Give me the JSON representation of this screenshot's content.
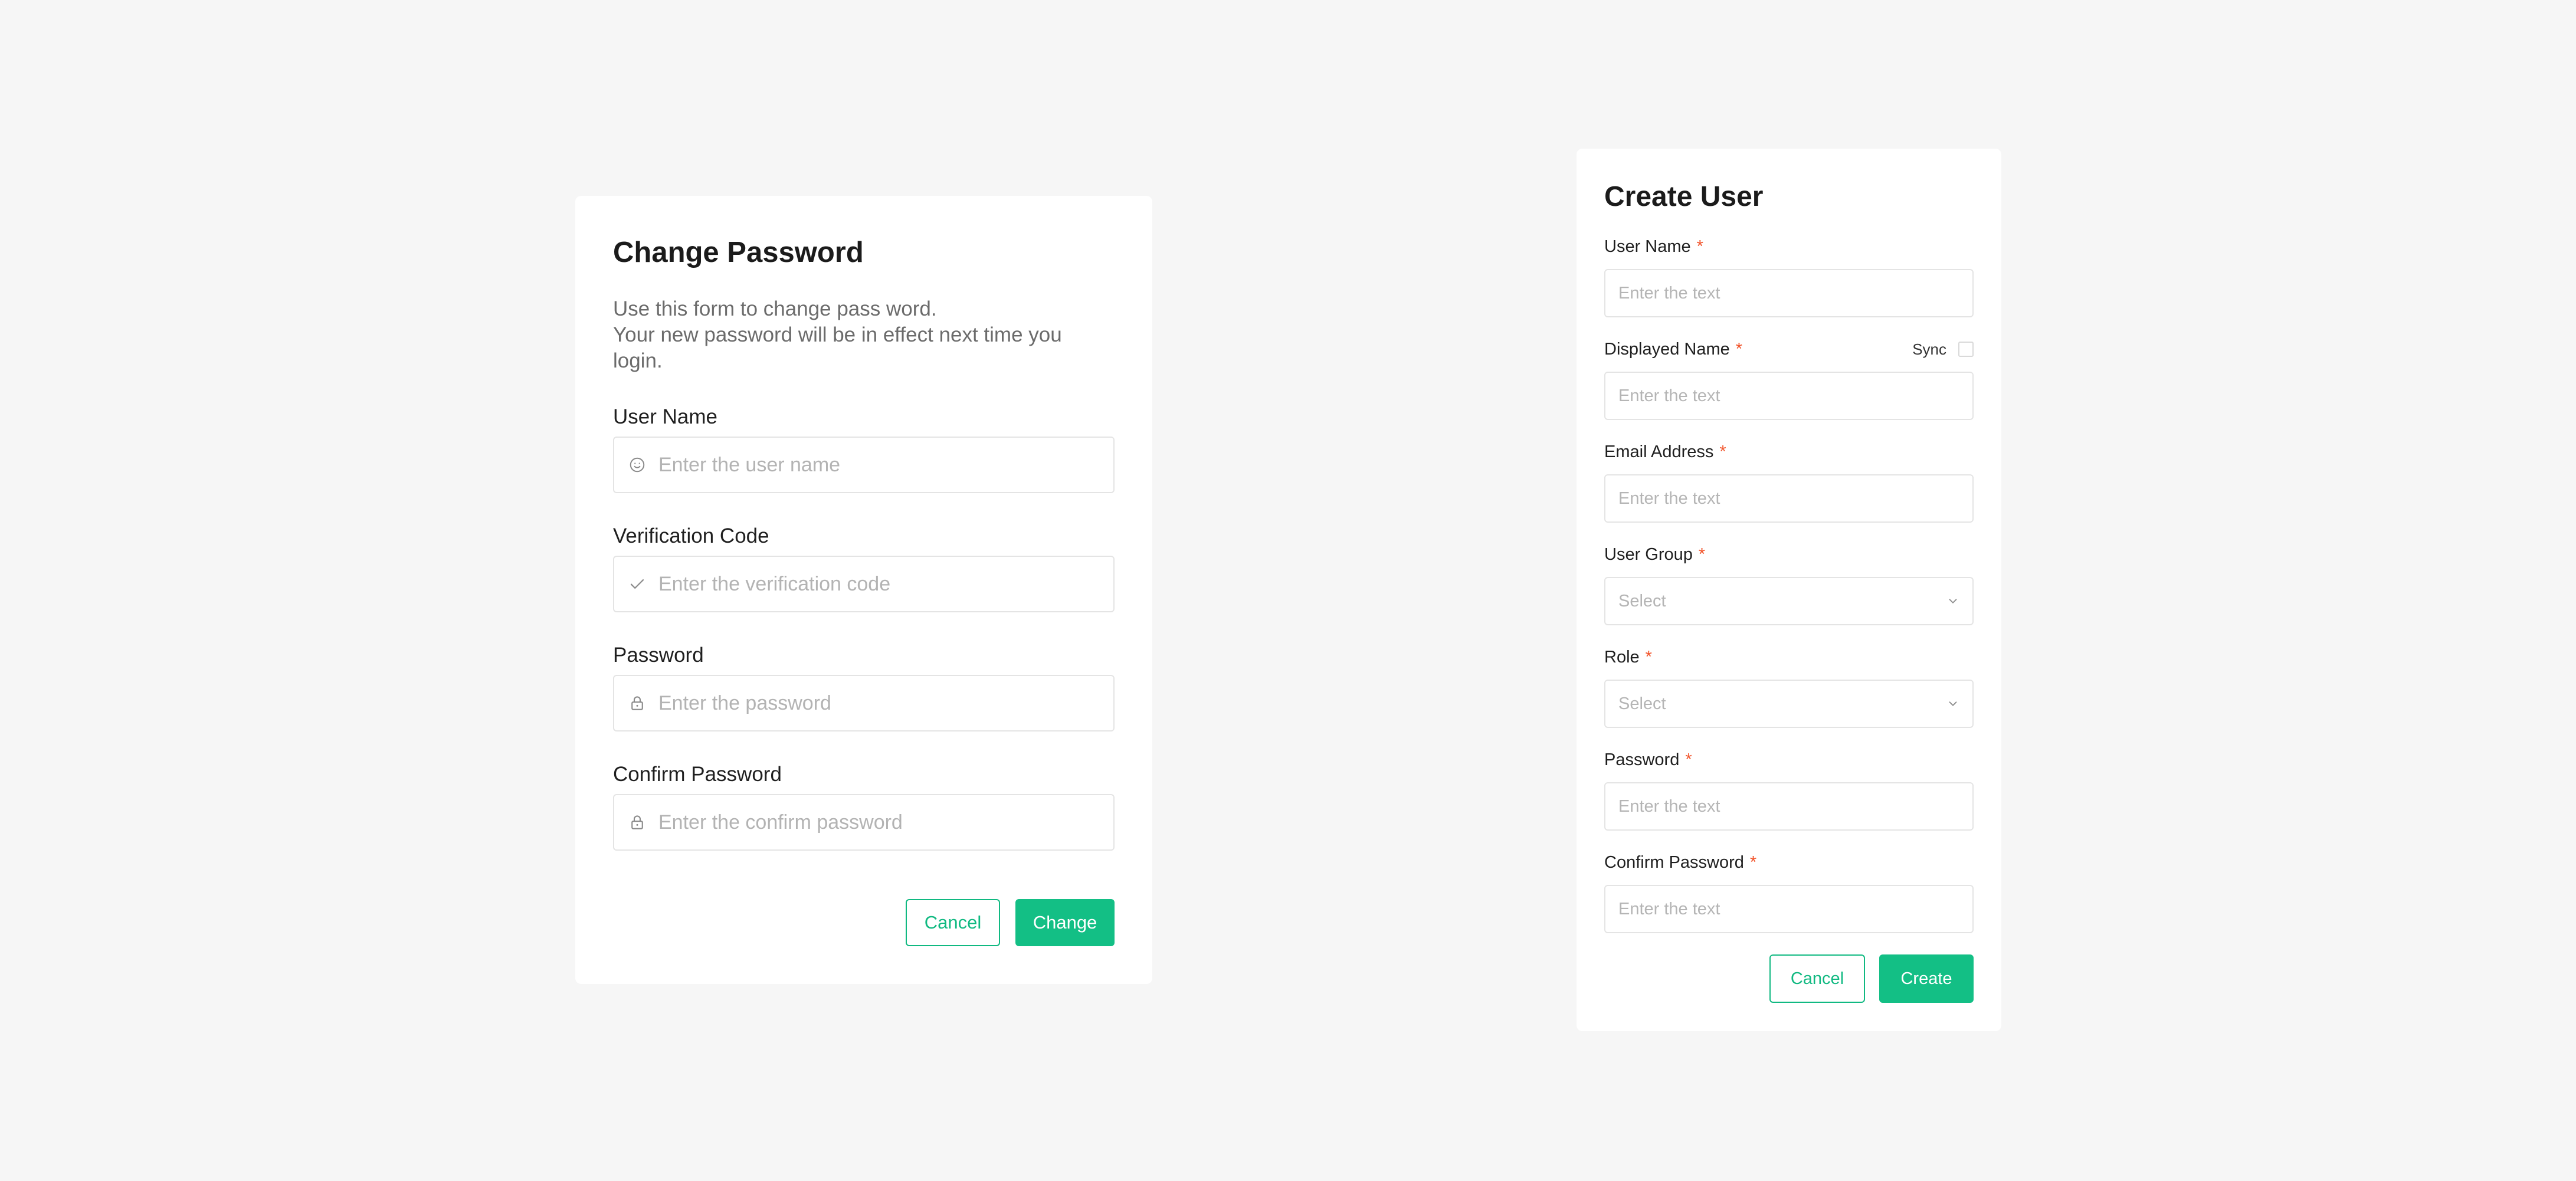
{
  "change_password": {
    "title": "Change Password",
    "description_line1": "Use this form to change pass word.",
    "description_line2": "Your new password will be in effect next time you login.",
    "fields": [
      {
        "label": "User Name",
        "placeholder": "Enter the user name",
        "icon": "smiley-icon"
      },
      {
        "label": "Verification Code",
        "placeholder": "Enter the verification code",
        "icon": "check-icon"
      },
      {
        "label": "Password",
        "placeholder": "Enter the password",
        "icon": "lock-icon"
      },
      {
        "label": "Confirm Password",
        "placeholder": "Enter the confirm password",
        "icon": "lock-icon"
      }
    ],
    "cancel_label": "Cancel",
    "change_label": "Change"
  },
  "create_user": {
    "title": "Create User",
    "required_mark": "*",
    "sync_label": "Sync",
    "fields": [
      {
        "label": "User Name",
        "placeholder": "Enter the text",
        "type": "text"
      },
      {
        "label": "Displayed Name",
        "placeholder": "Enter the text",
        "type": "text"
      },
      {
        "label": "Email Address",
        "placeholder": "Enter the text",
        "type": "text"
      },
      {
        "label": "User Group",
        "placeholder": "Select",
        "type": "select"
      },
      {
        "label": "Role",
        "placeholder": "Select",
        "type": "select"
      },
      {
        "label": "Password",
        "placeholder": "Enter the text",
        "type": "text"
      },
      {
        "label": "Confirm Password",
        "placeholder": "Enter the text",
        "type": "text"
      }
    ],
    "cancel_label": "Cancel",
    "create_label": "Create"
  },
  "colors": {
    "background": "#f6f6f6",
    "accent": "#13bf85",
    "required": "#f2552c"
  }
}
